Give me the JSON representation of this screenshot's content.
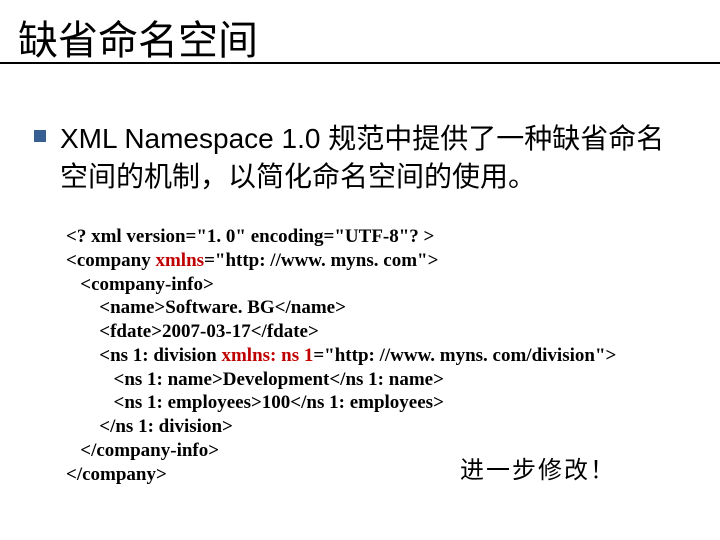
{
  "title": "缺省命名空间",
  "bullet": "XML Namespace 1.0 规范中提供了一种缺省命名空间的机制，以简化命名空间的使用。",
  "code": {
    "l1a": "<? xml version=\"1. 0\" encoding=\"UTF-8\"? >",
    "l2a": "<company ",
    "l2b": "xmlns",
    "l2c": "=\"http: //www. myns. com\">",
    "l3": "   <company-info>",
    "l4": "       <name>Software. BG</name>",
    "l5": "       <fdate>2007-03-17</fdate>",
    "l6a": "       <ns 1: division ",
    "l6b": "xmlns: ns 1",
    "l6c": "=\"http: //www. myns. com/division\">",
    "l7": "          <ns 1: name>Development</ns 1: name>",
    "l8": "          <ns 1: employees>100</ns 1: employees>",
    "l9": "       </ns 1: division>",
    "l10": "   </company-info>",
    "l11": "</company>"
  },
  "footnote": "进一步修改！"
}
